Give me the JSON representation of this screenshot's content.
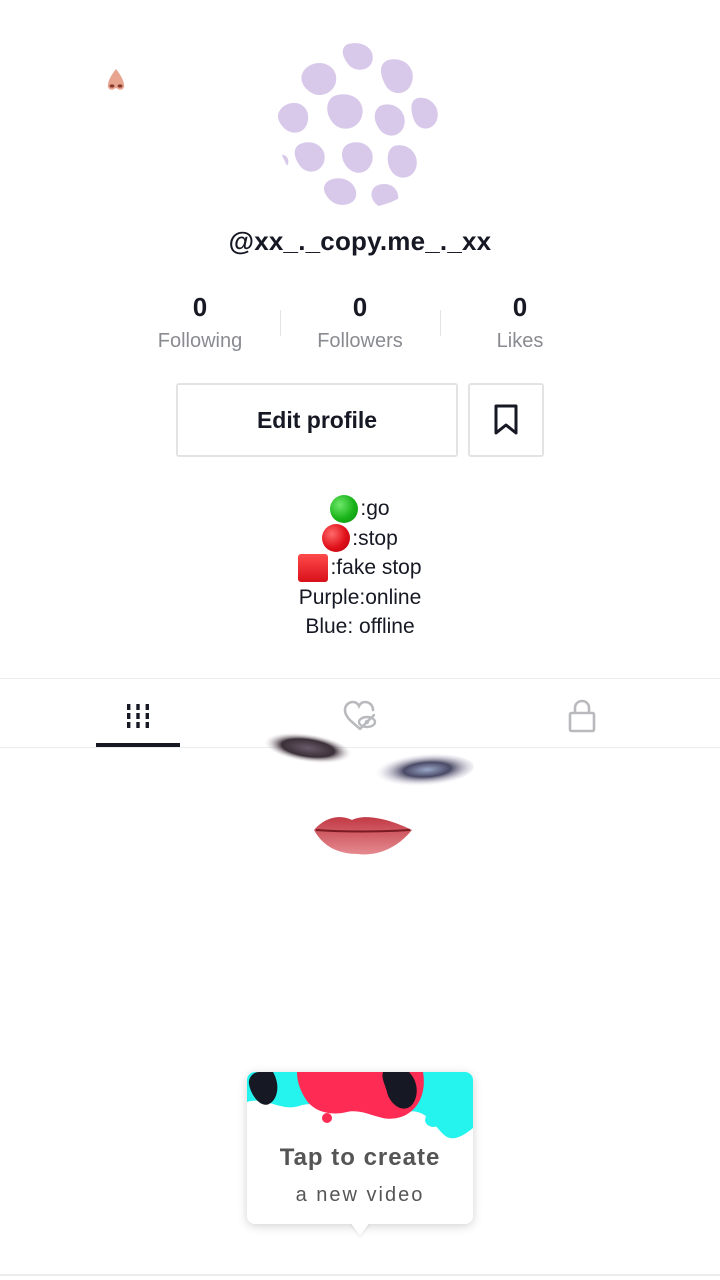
{
  "profile": {
    "username": "@xx_._copy.me_._xx"
  },
  "stats": {
    "following": {
      "count": "0",
      "label": "Following"
    },
    "followers": {
      "count": "0",
      "label": "Followers"
    },
    "likes": {
      "count": "0",
      "label": "Likes"
    }
  },
  "actions": {
    "edit_profile_label": "Edit profile",
    "favorites_icon": "bookmark-icon"
  },
  "bio": {
    "line1": ":go",
    "line2": ":stop",
    "line3": ":fake stop",
    "line4": "Purple:online",
    "line5": "Blue: offline"
  },
  "tabs": [
    {
      "icon": "grid-icon",
      "selected": true
    },
    {
      "icon": "hidden-likes-icon",
      "selected": false
    },
    {
      "icon": "lock-icon",
      "selected": false
    }
  ],
  "create_prompt": {
    "title": "Tap to create",
    "subtitle": "a new video"
  },
  "colors": {
    "text_primary": "#161823",
    "text_secondary": "#8a8b91",
    "border": "#e3e3e4",
    "avatar_pattern": "#d8c8ea",
    "brand_pink": "#fe2c55",
    "brand_cyan": "#25f4ee"
  }
}
